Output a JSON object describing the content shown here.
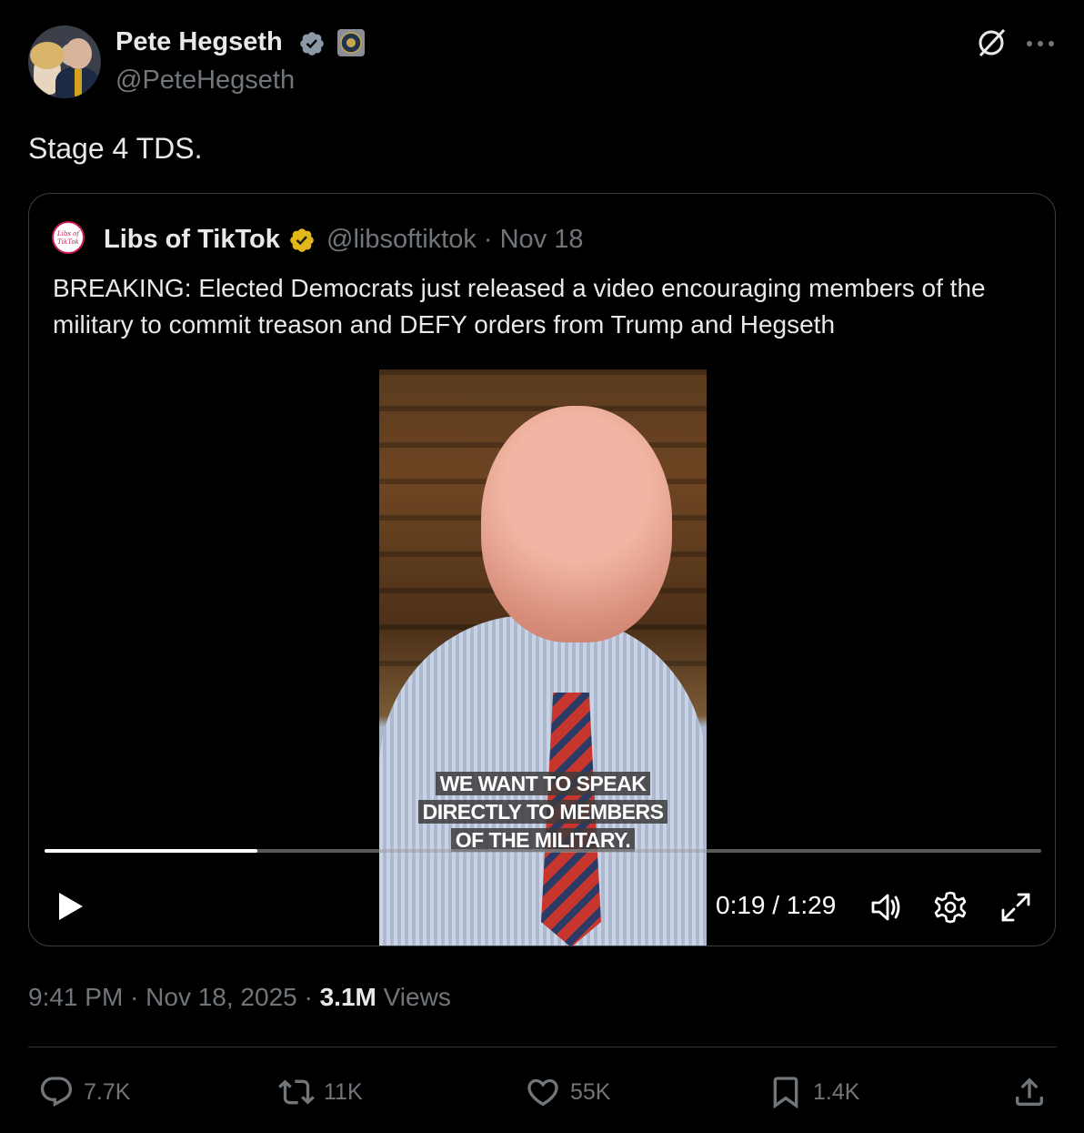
{
  "author": {
    "name": "Pete Hegseth",
    "handle": "@PeteHegseth"
  },
  "post": {
    "text": "Stage 4 TDS."
  },
  "quote": {
    "avatar_text": "Libs of TikTok",
    "name": "Libs of TikTok",
    "handle_date": "@libsoftiktok · Nov 18",
    "text": "BREAKING: Elected Democrats just released a video encouraging members of the military to commit treason and DEFY orders from Trump and Hegseth"
  },
  "video": {
    "caption_lines": [
      "WE WANT TO SPEAK",
      "DIRECTLY TO MEMBERS",
      "OF THE MILITARY."
    ],
    "time": "0:19 / 1:29",
    "progress": 0.2135
  },
  "meta": {
    "timestamp": "9:41 PM · Nov 18, 2025 · ",
    "views_count": "3.1M",
    "views_label": " Views"
  },
  "actions": {
    "replies": "7.7K",
    "reposts": "11K",
    "likes": "55K",
    "bookmarks": "1.4K"
  },
  "colors": {
    "background": "#000000",
    "text": "#e7e9ea",
    "secondary": "#71767b",
    "verified_blue": "#1d9bf0",
    "verified_gold": "#e2b719"
  }
}
